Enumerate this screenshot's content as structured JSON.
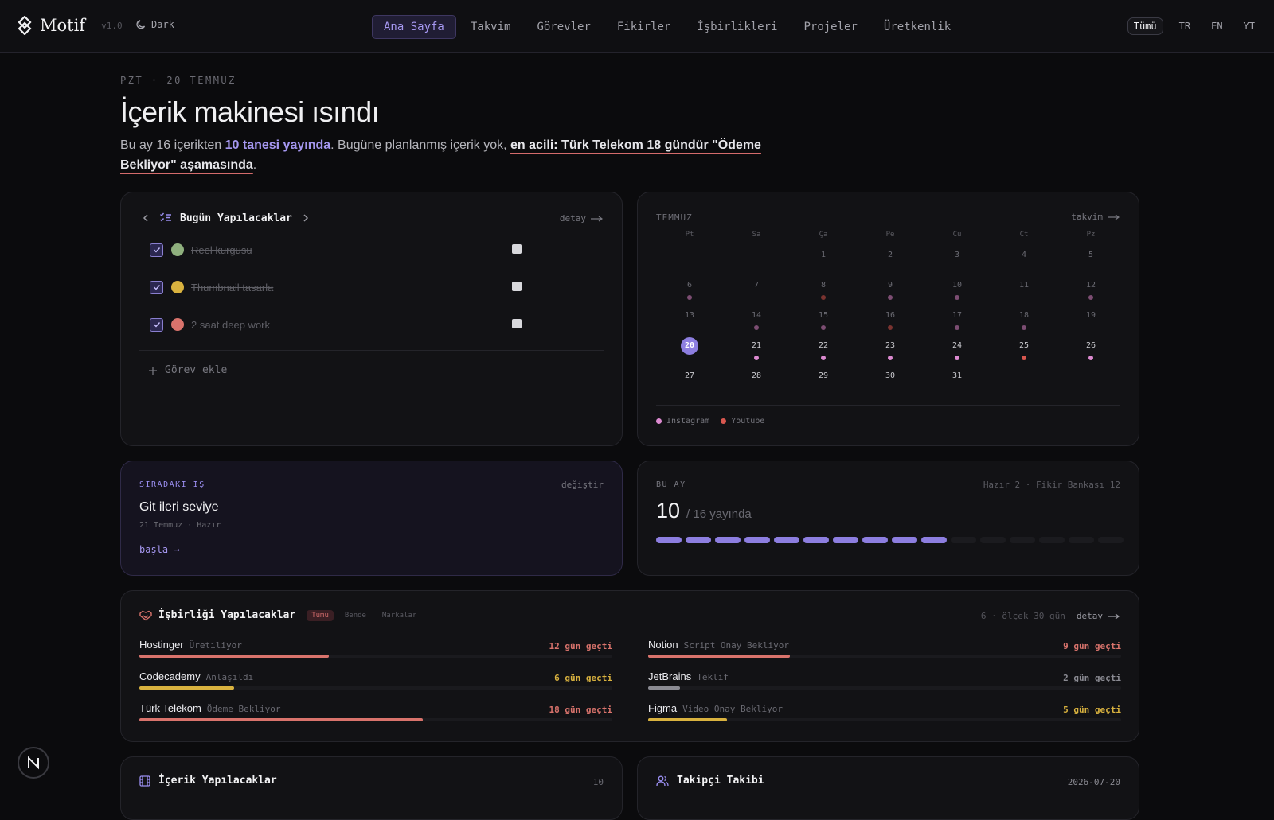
{
  "app": {
    "name": "Motif",
    "version": "v1.0",
    "theme_label": "Dark"
  },
  "nav": [
    {
      "label": "Ana Sayfa",
      "active": true
    },
    {
      "label": "Takvim"
    },
    {
      "label": "Görevler"
    },
    {
      "label": "Fikirler"
    },
    {
      "label": "İşbirlikleri"
    },
    {
      "label": "Projeler"
    },
    {
      "label": "Üretkenlik"
    }
  ],
  "langs": [
    {
      "label": "Tümü",
      "active": true
    },
    {
      "label": "TR"
    },
    {
      "label": "EN"
    },
    {
      "label": "YT"
    }
  ],
  "header": {
    "date": "PZT · 20 TEMMUZ",
    "title": "İçerik makinesi ısındı",
    "summary_pre": "Bu ay 16 içerikten ",
    "summary_pub": "10 tanesi yayında",
    "summary_mid": ". Bugüne planlanmış içerik yok, ",
    "summary_urgent": "en acili: Türk Telekom 18 gündür \"Ödeme Bekliyor\" aşamasında",
    "summary_end": "."
  },
  "today": {
    "title": "Bugün Yapılacaklar",
    "detail": "detay",
    "tasks": [
      {
        "label": "Reel kurgusu",
        "color": "#8fb07e",
        "done": true
      },
      {
        "label": "Thumbnail tasarla",
        "color": "#d9b23f",
        "done": true
      },
      {
        "label": "2 saat deep work",
        "color": "#d9736c",
        "done": true
      }
    ],
    "add_label": "Görev ekle"
  },
  "calendar": {
    "month": "TEMMUZ",
    "link": "takvim",
    "weekdays": [
      "Pt",
      "Sa",
      "Ça",
      "Pe",
      "Cu",
      "Ct",
      "Pz"
    ],
    "first_weekday_index": 2,
    "today": 20,
    "days": [
      {
        "d": 1
      },
      {
        "d": 2
      },
      {
        "d": 3
      },
      {
        "d": 4
      },
      {
        "d": 5
      },
      {
        "d": 6,
        "dot": "#7c4d72"
      },
      {
        "d": 7
      },
      {
        "d": 8,
        "dot": "#7a3330"
      },
      {
        "d": 9,
        "dot": "#7c4d72"
      },
      {
        "d": 10,
        "dot": "#7c4d72"
      },
      {
        "d": 11
      },
      {
        "d": 12,
        "dot": "#7c4d72"
      },
      {
        "d": 13
      },
      {
        "d": 14,
        "dot": "#7c4d72"
      },
      {
        "d": 15,
        "dot": "#7c4d72"
      },
      {
        "d": 16,
        "dot": "#7a3330"
      },
      {
        "d": 17,
        "dot": "#7c4d72"
      },
      {
        "d": 18,
        "dot": "#7c4d72"
      },
      {
        "d": 19
      },
      {
        "d": 20
      },
      {
        "d": 21,
        "dot": "#dc8ad0"
      },
      {
        "d": 22,
        "dot": "#dc8ad0"
      },
      {
        "d": 23,
        "dot": "#dc8ad0"
      },
      {
        "d": 24,
        "dot": "#dc8ad0"
      },
      {
        "d": 25,
        "dot": "#d8574f"
      },
      {
        "d": 26,
        "dot": "#dc8ad0"
      },
      {
        "d": 27
      },
      {
        "d": 28
      },
      {
        "d": 29
      },
      {
        "d": 30
      },
      {
        "d": 31
      }
    ],
    "legend": [
      {
        "label": "Instagram",
        "color": "#dc8ad0"
      },
      {
        "label": "Youtube",
        "color": "#d8574f"
      }
    ]
  },
  "next_task": {
    "caption": "SIRADAKİ İŞ",
    "change": "değiştir",
    "title": "Git ileri seviye",
    "meta": "21 Temmuz · Hazır",
    "start": "başla →"
  },
  "month_stats": {
    "caption": "BU AY",
    "right": "Hazır 2 · Fikir Bankası 12",
    "published": "10",
    "total_label": "/ 16 yayında",
    "published_count": 10,
    "total_count": 16
  },
  "collab": {
    "title": "İşbirliği Yapılacaklar",
    "filters": [
      {
        "label": "Tümü",
        "active": true
      },
      {
        "label": "Bende"
      },
      {
        "label": "Markalar"
      }
    ],
    "meta": "6 · ölçek 30 gün",
    "detail": "detay",
    "items": [
      {
        "name": "Hostinger",
        "status": "Üretiliyor",
        "ago": "12 gün geçti",
        "days": 12,
        "color": "#d9736c"
      },
      {
        "name": "Notion",
        "status": "Script Onay Bekliyor",
        "ago": "9 gün geçti",
        "days": 9,
        "color": "#d9736c"
      },
      {
        "name": "Codecademy",
        "status": "Anlaşıldı",
        "ago": "6 gün geçti",
        "days": 6,
        "color": "#d9b23f"
      },
      {
        "name": "JetBrains",
        "status": "Teklif",
        "ago": "2 gün geçti",
        "days": 2,
        "color": "#8a8a92"
      },
      {
        "name": "Türk Telekom",
        "status": "Ödeme Bekliyor",
        "ago": "18 gün geçti",
        "days": 18,
        "color": "#d9736c"
      },
      {
        "name": "Figma",
        "status": "Video Onay Bekliyor",
        "ago": "5 gün geçti",
        "days": 5,
        "color": "#d9b23f"
      }
    ]
  },
  "content_todo": {
    "title": "İçerik Yapılacaklar",
    "count": "10"
  },
  "follower": {
    "title": "Takipçi Takibi",
    "date": "2026-07-20"
  },
  "fab": {
    "label": "N"
  }
}
